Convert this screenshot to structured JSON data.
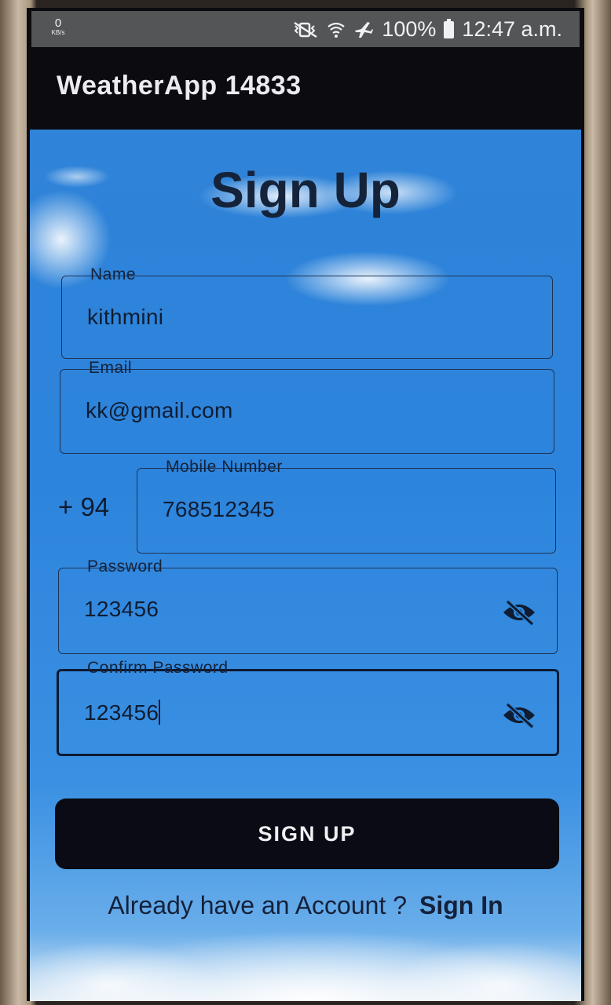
{
  "status_bar": {
    "netspeed_value": "0",
    "netspeed_unit": "KB/s",
    "battery": "100%",
    "time": "12:47 a.m."
  },
  "app_bar": {
    "title": "WeatherApp 14833"
  },
  "form": {
    "title": "Sign Up",
    "name": {
      "label": "Name",
      "value": "kithmini"
    },
    "email": {
      "label": "Email",
      "value": "kk@gmail.com"
    },
    "mobile": {
      "country_code": "+ 94",
      "label": "Mobile Number",
      "value": "768512345"
    },
    "password": {
      "label": "Password",
      "value": "123456"
    },
    "confirm_password": {
      "label": "Confirm Password",
      "value": "123456"
    },
    "submit_label": "SIGN UP",
    "footer_prompt": "Already have an Account ?",
    "footer_link": "Sign In"
  },
  "icons": {
    "status": [
      "mute-vibrate-icon",
      "wifi-icon",
      "airplane-mode-icon",
      "battery-icon"
    ],
    "password_toggle": "eye-off-icon"
  },
  "colors": {
    "button_bg": "#0a0b14",
    "sky_blue": "#2d84dc",
    "app_bar": "#0c0b10",
    "text_dark": "#15233a"
  }
}
